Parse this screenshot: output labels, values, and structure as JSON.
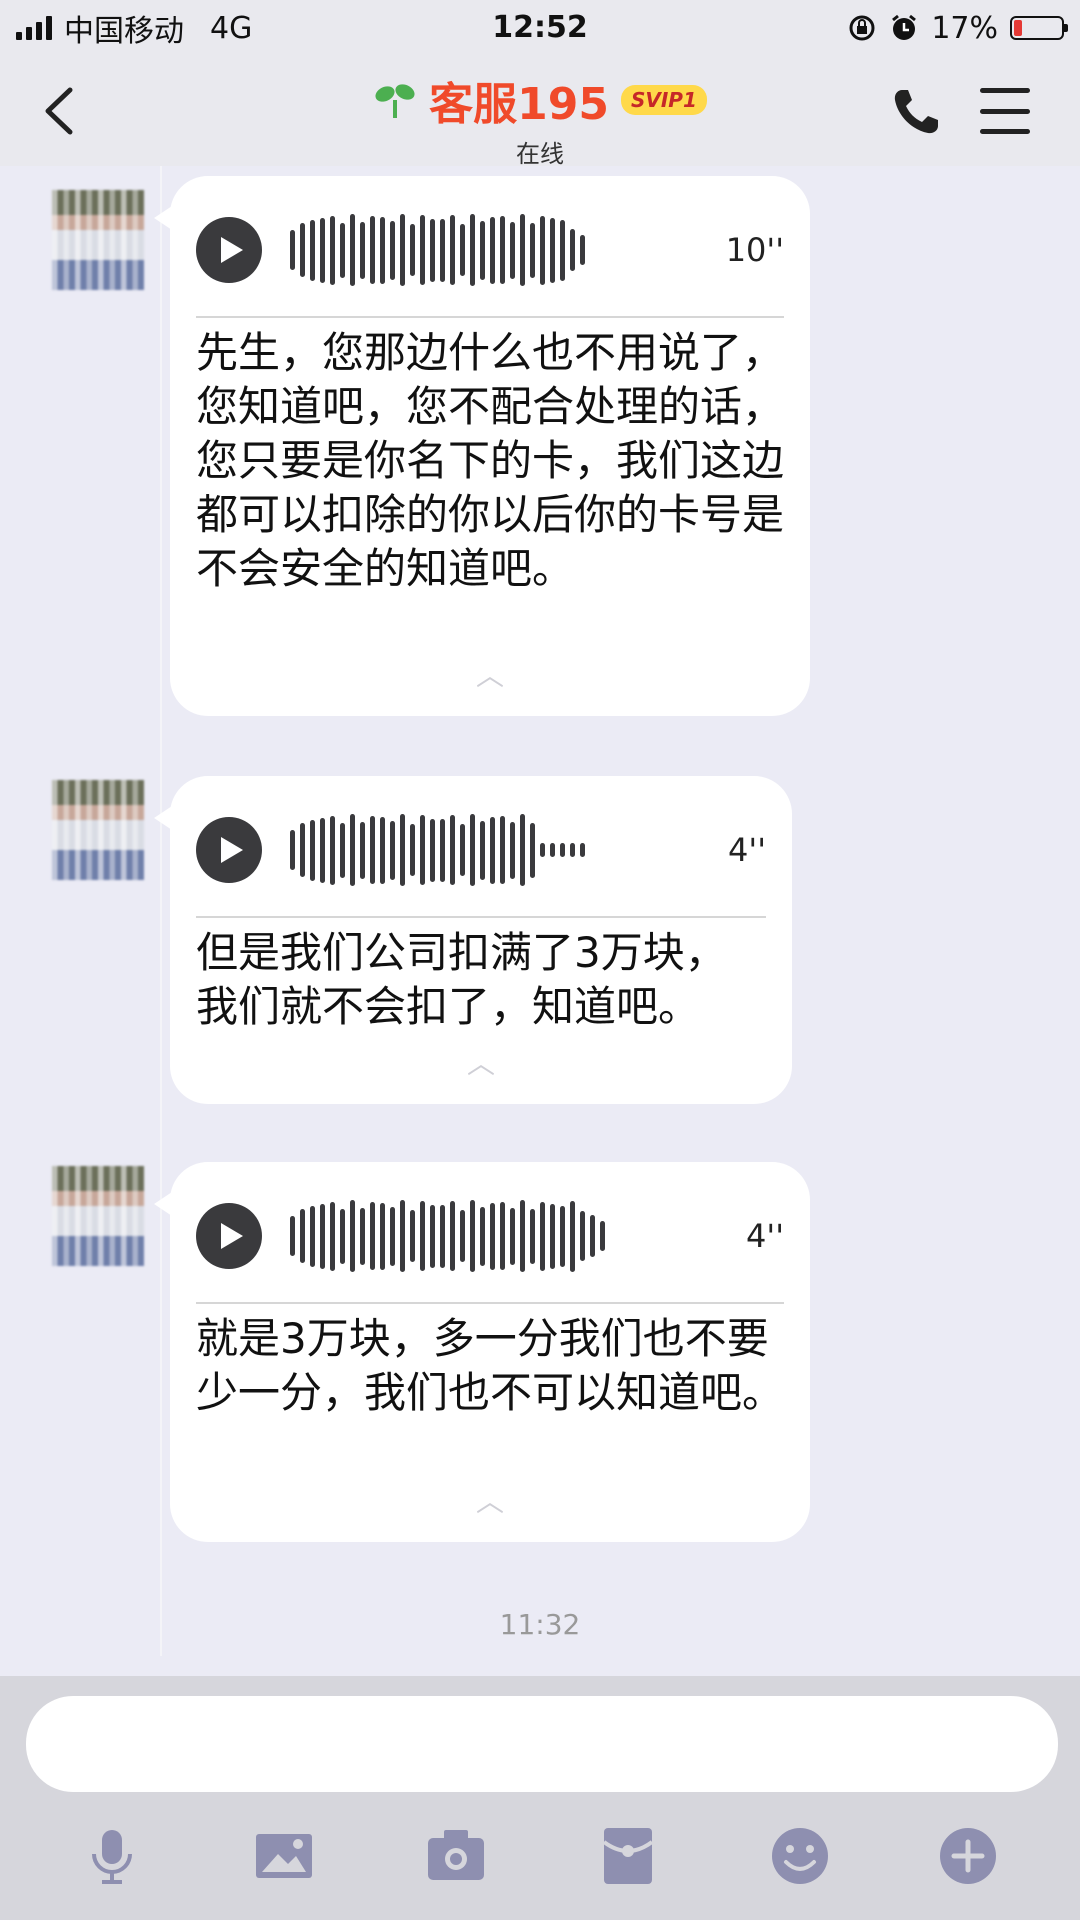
{
  "status_bar": {
    "carrier": "中国移动",
    "network": "4G",
    "time": "12:52",
    "battery_percent": "17%",
    "battery_level": 0.17
  },
  "header": {
    "title": "客服195",
    "badge": "SVIP1",
    "subtitle": "在线"
  },
  "messages": [
    {
      "duration": "10''",
      "transcript": "先生，您那边什么也不用说了，您知道吧，您不配合处理的话，您只要是你名下的卡，我们这边都可以扣除的你以后你的卡号是不会安全的知道吧。"
    },
    {
      "duration": "4''",
      "transcript": "但是我们公司扣满了3万块，我们就不会扣了，知道吧。"
    },
    {
      "duration": "4''",
      "transcript": "就是3万块，多一分我们也不要少一分，我们也不可以知道吧。"
    }
  ],
  "timestamp": "11:32",
  "input": {
    "value": "",
    "placeholder": ""
  },
  "toolbar": [
    "microphone-icon",
    "image-icon",
    "camera-icon",
    "red-packet-icon",
    "emoji-icon",
    "plus-icon"
  ],
  "colors": {
    "title": "#f04a2a",
    "badge_bg": "#ffd94a",
    "background": "#ebebf5",
    "icons": "#8e8fb0"
  }
}
